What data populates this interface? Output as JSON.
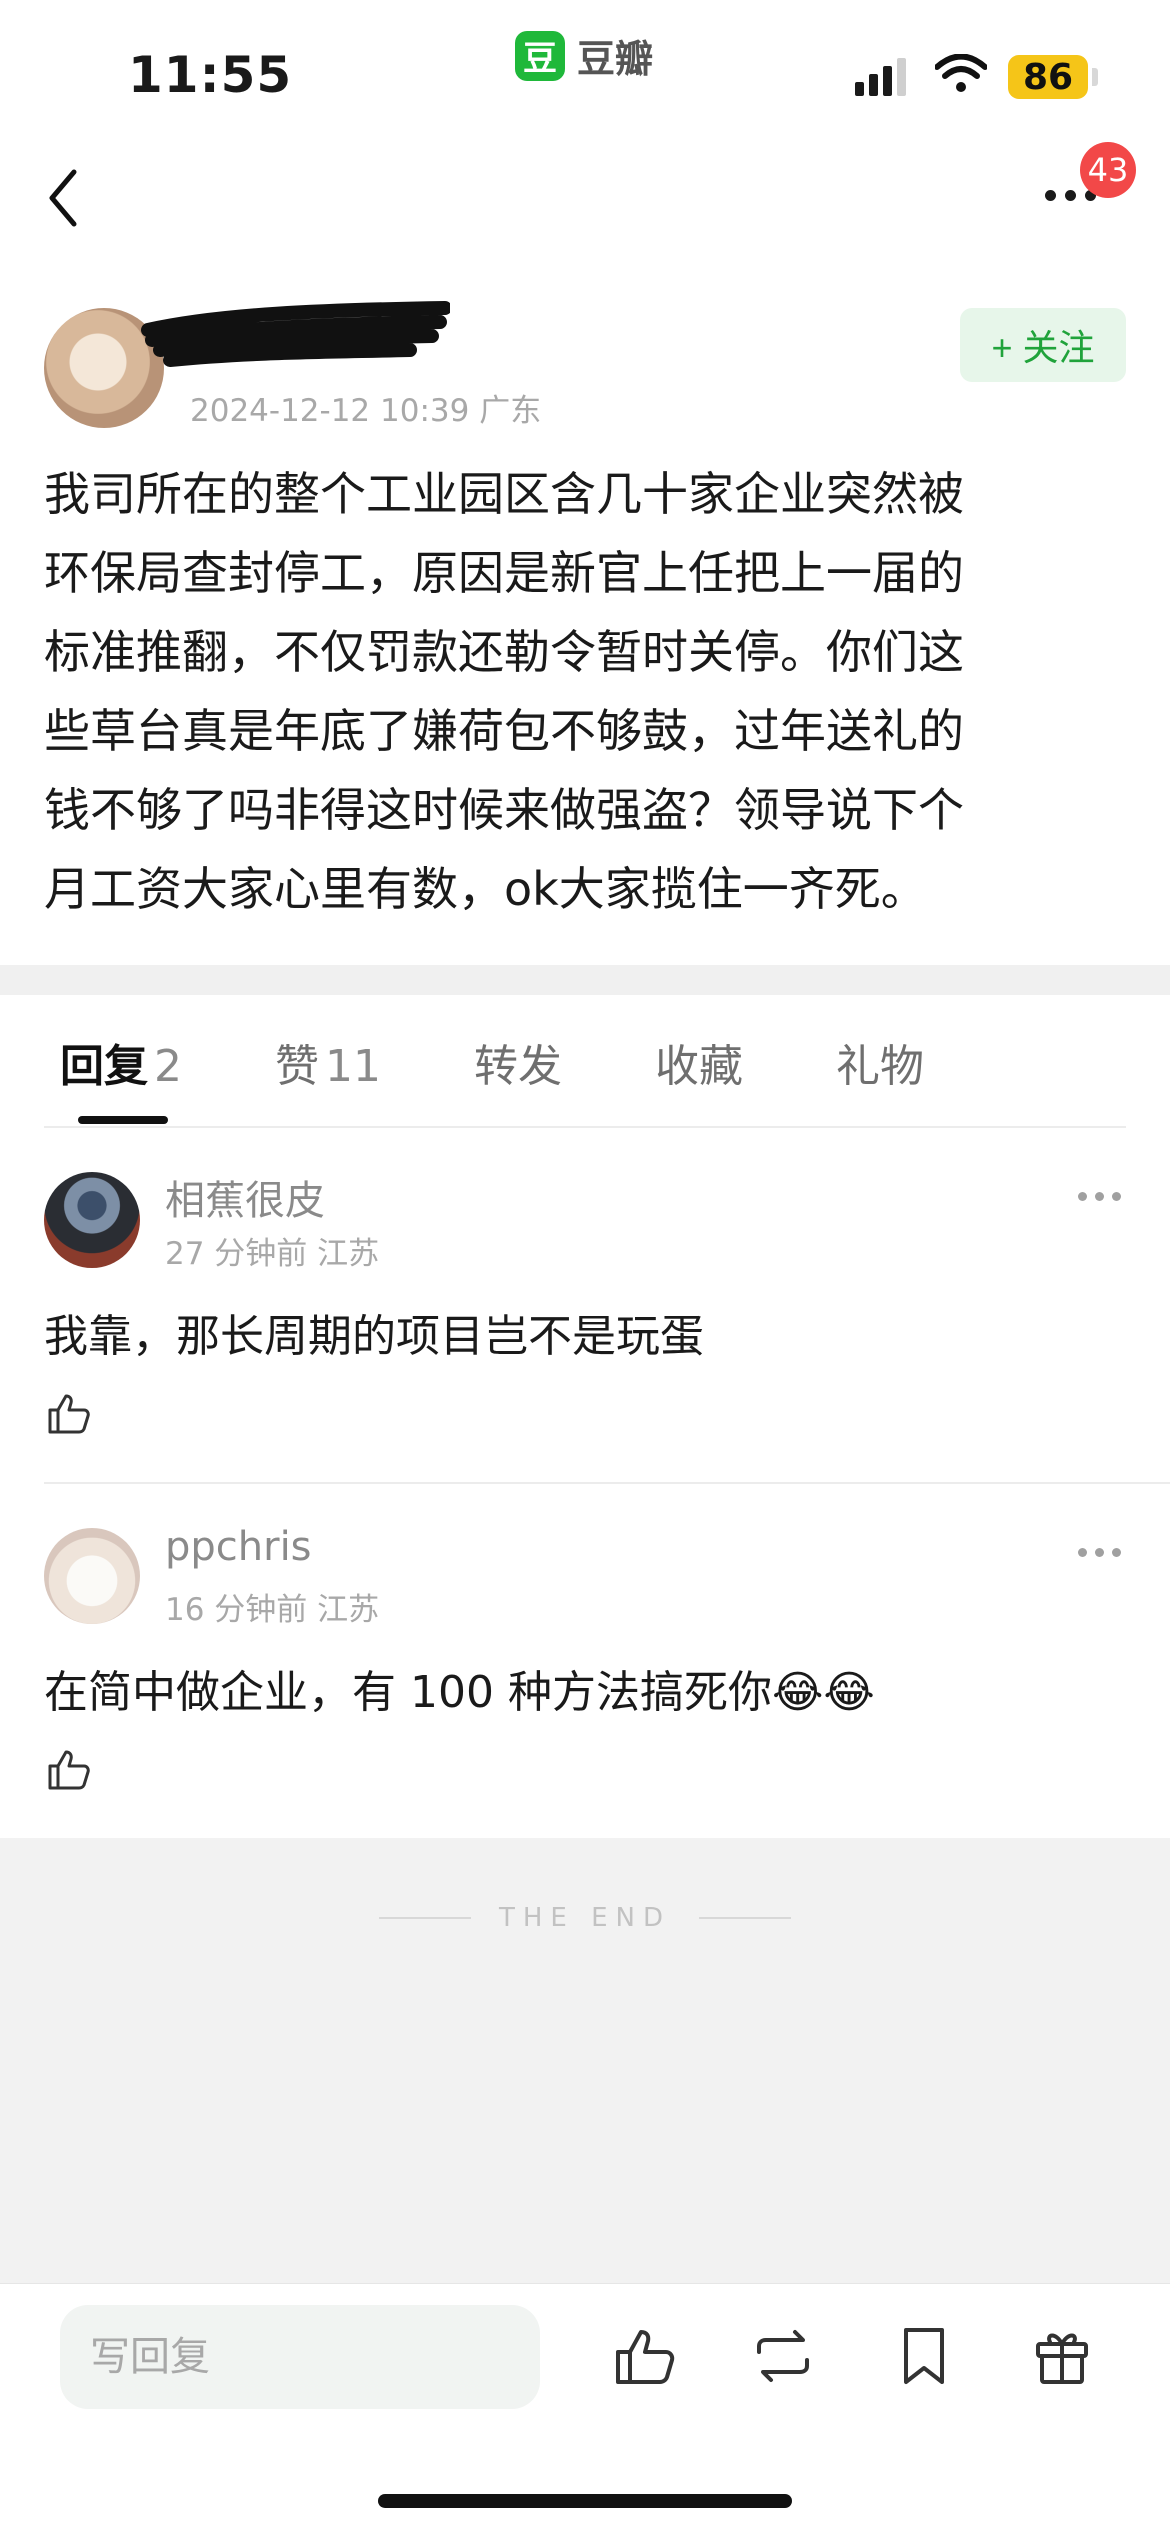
{
  "status_bar": {
    "time": "11:55",
    "app_logo_char": "豆",
    "app_name": "豆瓣",
    "battery": "86"
  },
  "nav": {
    "notification_badge": "43"
  },
  "post": {
    "meta": "2024-12-12 10:39 广东",
    "follow_label": "+ 关注",
    "body_lines": [
      "我司所在的整个工业园区含几十家企业突然被",
      "环保局查封停工，原因是新官上任把上一届的",
      "标准推翻，不仅罚款还勒令暂时关停。你们这",
      "些草台真是年底了嫌荷包不够鼓，过年送礼的",
      "钱不够了吗非得这时候来做强盗？领导说下个",
      "月工资大家心里有数，ok大家揽住一齐死。"
    ]
  },
  "tabs": [
    {
      "label": "回复",
      "count": "2"
    },
    {
      "label": "赞",
      "count": "11"
    },
    {
      "label": "转发",
      "count": ""
    },
    {
      "label": "收藏",
      "count": ""
    },
    {
      "label": "礼物",
      "count": ""
    }
  ],
  "comments": [
    {
      "name": "相蕉很皮",
      "meta": "27 分钟前 江苏",
      "text": "我靠，那长周期的项目岂不是玩蛋"
    },
    {
      "name": "ppchris",
      "meta": "16 分钟前 江苏",
      "text": "在简中做企业，有 100 种方法搞死你😂😂"
    }
  ],
  "end_text": "THE END",
  "bottom_bar": {
    "reply_placeholder": "写回复",
    "icons": [
      "thumbs-up-icon",
      "repost-icon",
      "bookmark-icon",
      "gift-icon"
    ]
  },
  "colors": {
    "accent_green": "#20a33b",
    "follow_bg": "#e7f6ea",
    "badge_red": "#f24848",
    "battery_yellow": "#f5c518"
  }
}
